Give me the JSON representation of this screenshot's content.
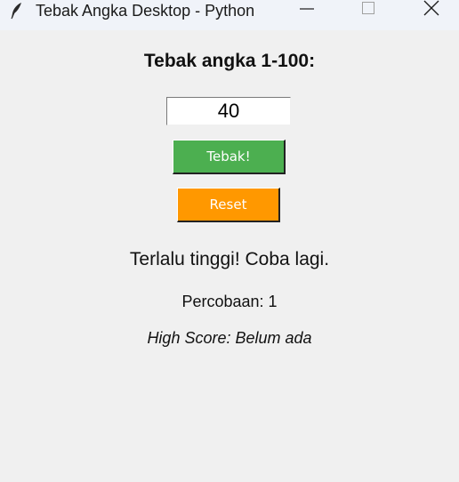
{
  "window": {
    "title": "Tebak Angka Desktop - Python",
    "icons": {
      "app": "feather-icon",
      "minimize": "minimize-icon",
      "maximize": "maximize-icon",
      "close": "close-icon"
    }
  },
  "game": {
    "heading": "Tebak angka 1-100:",
    "guess_value": "40",
    "guess_button_label": "Tebak!",
    "reset_button_label": "Reset",
    "feedback": "Terlalu tinggi! Coba lagi.",
    "attempts": "Percobaan: 1",
    "high_score": "High Score: Belum ada"
  },
  "colors": {
    "guess_button": "#4caf50",
    "reset_button": "#ff9800",
    "background": "#f0f0f0"
  }
}
